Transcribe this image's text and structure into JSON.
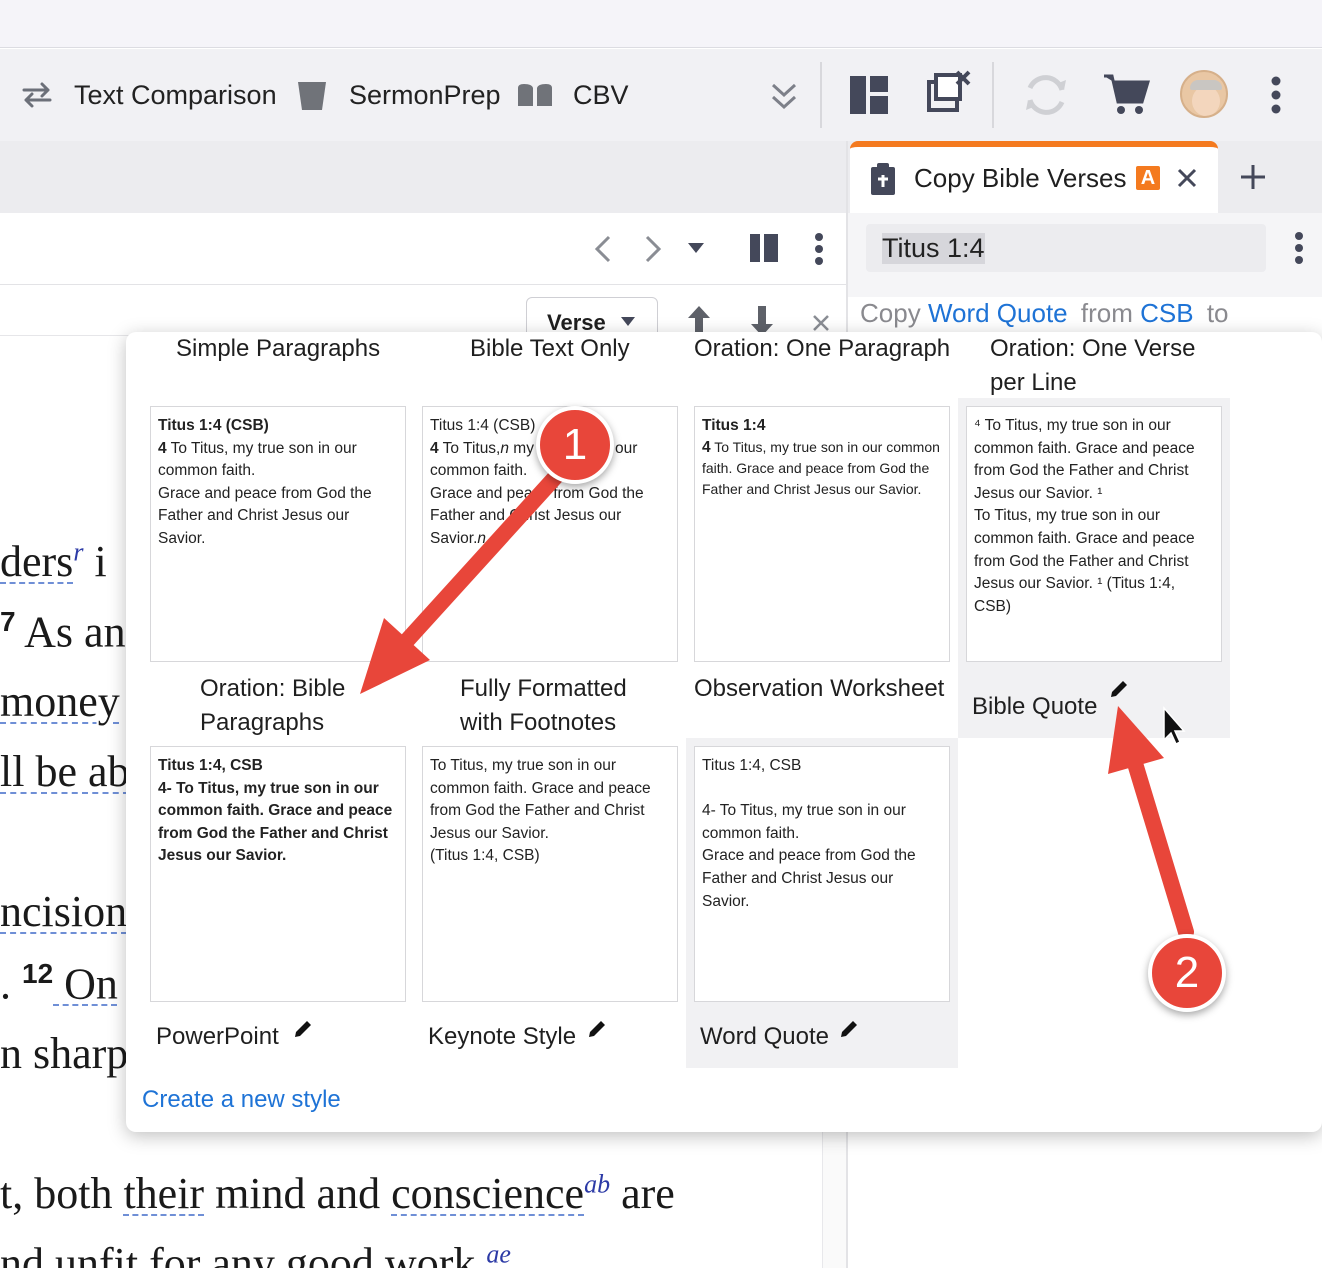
{
  "toolbar": {
    "items": [
      {
        "icon": "swap-arrows-icon",
        "label": "Text Comparison"
      },
      {
        "icon": "trash-can-icon",
        "label": "SermonPrep"
      },
      {
        "icon": "books-icon",
        "label": "CBV"
      }
    ],
    "right_icons": [
      "chevron-double-down-icon",
      "layout-icon",
      "close-windows-icon",
      "sync-icon",
      "cart-icon",
      "avatar",
      "more-vertical-icon"
    ]
  },
  "right_panel": {
    "tab_title": "Copy Bible Verses",
    "tab_badge": "A",
    "reference": "Titus 1:4",
    "copy_label": "Copy",
    "copy_style": "Word Quote",
    "from_label": "from",
    "version": "CSB",
    "to_label": "to"
  },
  "left_panel": {
    "verse_dropdown": "Verse",
    "text_lines": [
      {
        "parts": [
          "ders",
          "r",
          " i"
        ]
      },
      {
        "parts": [
          "7",
          " As an"
        ]
      },
      {
        "parts": [
          " money"
        ]
      },
      {
        "parts": [
          "ll be ab"
        ]
      },
      {
        "parts": [
          "ncision"
        ]
      },
      {
        "parts": [
          ". ",
          "12",
          " On"
        ]
      },
      {
        "parts": [
          "n sharp"
        ]
      },
      {
        "parts": [
          "t, both ",
          "their",
          " mind and ",
          "conscience",
          "ab",
          " are"
        ]
      },
      {
        "parts": [
          "nd unfit for any good work.",
          "ae"
        ]
      }
    ]
  },
  "popup": {
    "styles": [
      {
        "name": "Simple Paragraphs",
        "preview": ""
      },
      {
        "name": "Bible Text Only",
        "preview": ""
      },
      {
        "name": "Oration: One Paragraph",
        "preview": ""
      },
      {
        "name": "Oration: One Verse per Line",
        "preview": "⁴ To Titus, my true son in our common faith. Grace and peace from God the Father and Christ Jesus our Savior. ¹\nTo Titus, my true son in our common faith. Grace and peace from God the Father and Christ Jesus our Savior. ¹ (Titus 1:4, CSB)"
      },
      {
        "name": "Oration: Bible Paragraphs",
        "preview": ""
      },
      {
        "name": "Fully Formatted with Footnotes",
        "preview": ""
      },
      {
        "name": "Observation Worksheet",
        "preview": ""
      },
      {
        "name": "Bible Quote",
        "preview": ""
      },
      {
        "name": "PowerPoint",
        "preview": ""
      },
      {
        "name": "Keynote Style",
        "preview": ""
      },
      {
        "name": "Word Quote",
        "preview": ""
      }
    ],
    "card_simple": {
      "head": "Titus 1:4 (CSB)",
      "num": "4",
      "body": " To Titus, my true son in our common faith.\nGrace and peace from God the Father and Christ Jesus our Savior."
    },
    "card_bibletext": {
      "head": "Titus 1:4 (CSB)",
      "num": "4",
      "body": " To Titus,",
      "note": "n",
      "body2": " my true son in our common faith.\nGrace and peace from God the Father and Christ Jesus our Savior.",
      "note2": "n"
    },
    "card_oration": {
      "head": "Titus 1:4",
      "num": "4",
      "body": " To Titus, my true son in our common faith. Grace and peace from God the Father and Christ Jesus our Savior."
    },
    "card_oration_bible": {
      "text": "Titus 1:4, CSB\n4- To Titus, my true son in our common faith. Grace and peace from God the Father and Christ Jesus our Savior."
    },
    "card_formatted": {
      "text": "To Titus, my true son in our common faith. Grace and peace from God the Father and Christ Jesus our Savior.\n(Titus 1:4, CSB)"
    },
    "card_worksheet": {
      "text": "Titus 1:4, CSB\n\n4- To Titus, my true son in our common faith.\nGrace and peace from God the Father and Christ Jesus our Savior."
    },
    "create_link": "Create a new style"
  },
  "annotations": {
    "badge1": "1",
    "badge2": "2"
  },
  "colors": {
    "accent_orange": "#f47a1f",
    "link_blue": "#1e73d6",
    "annotation_red": "#e8463a"
  }
}
